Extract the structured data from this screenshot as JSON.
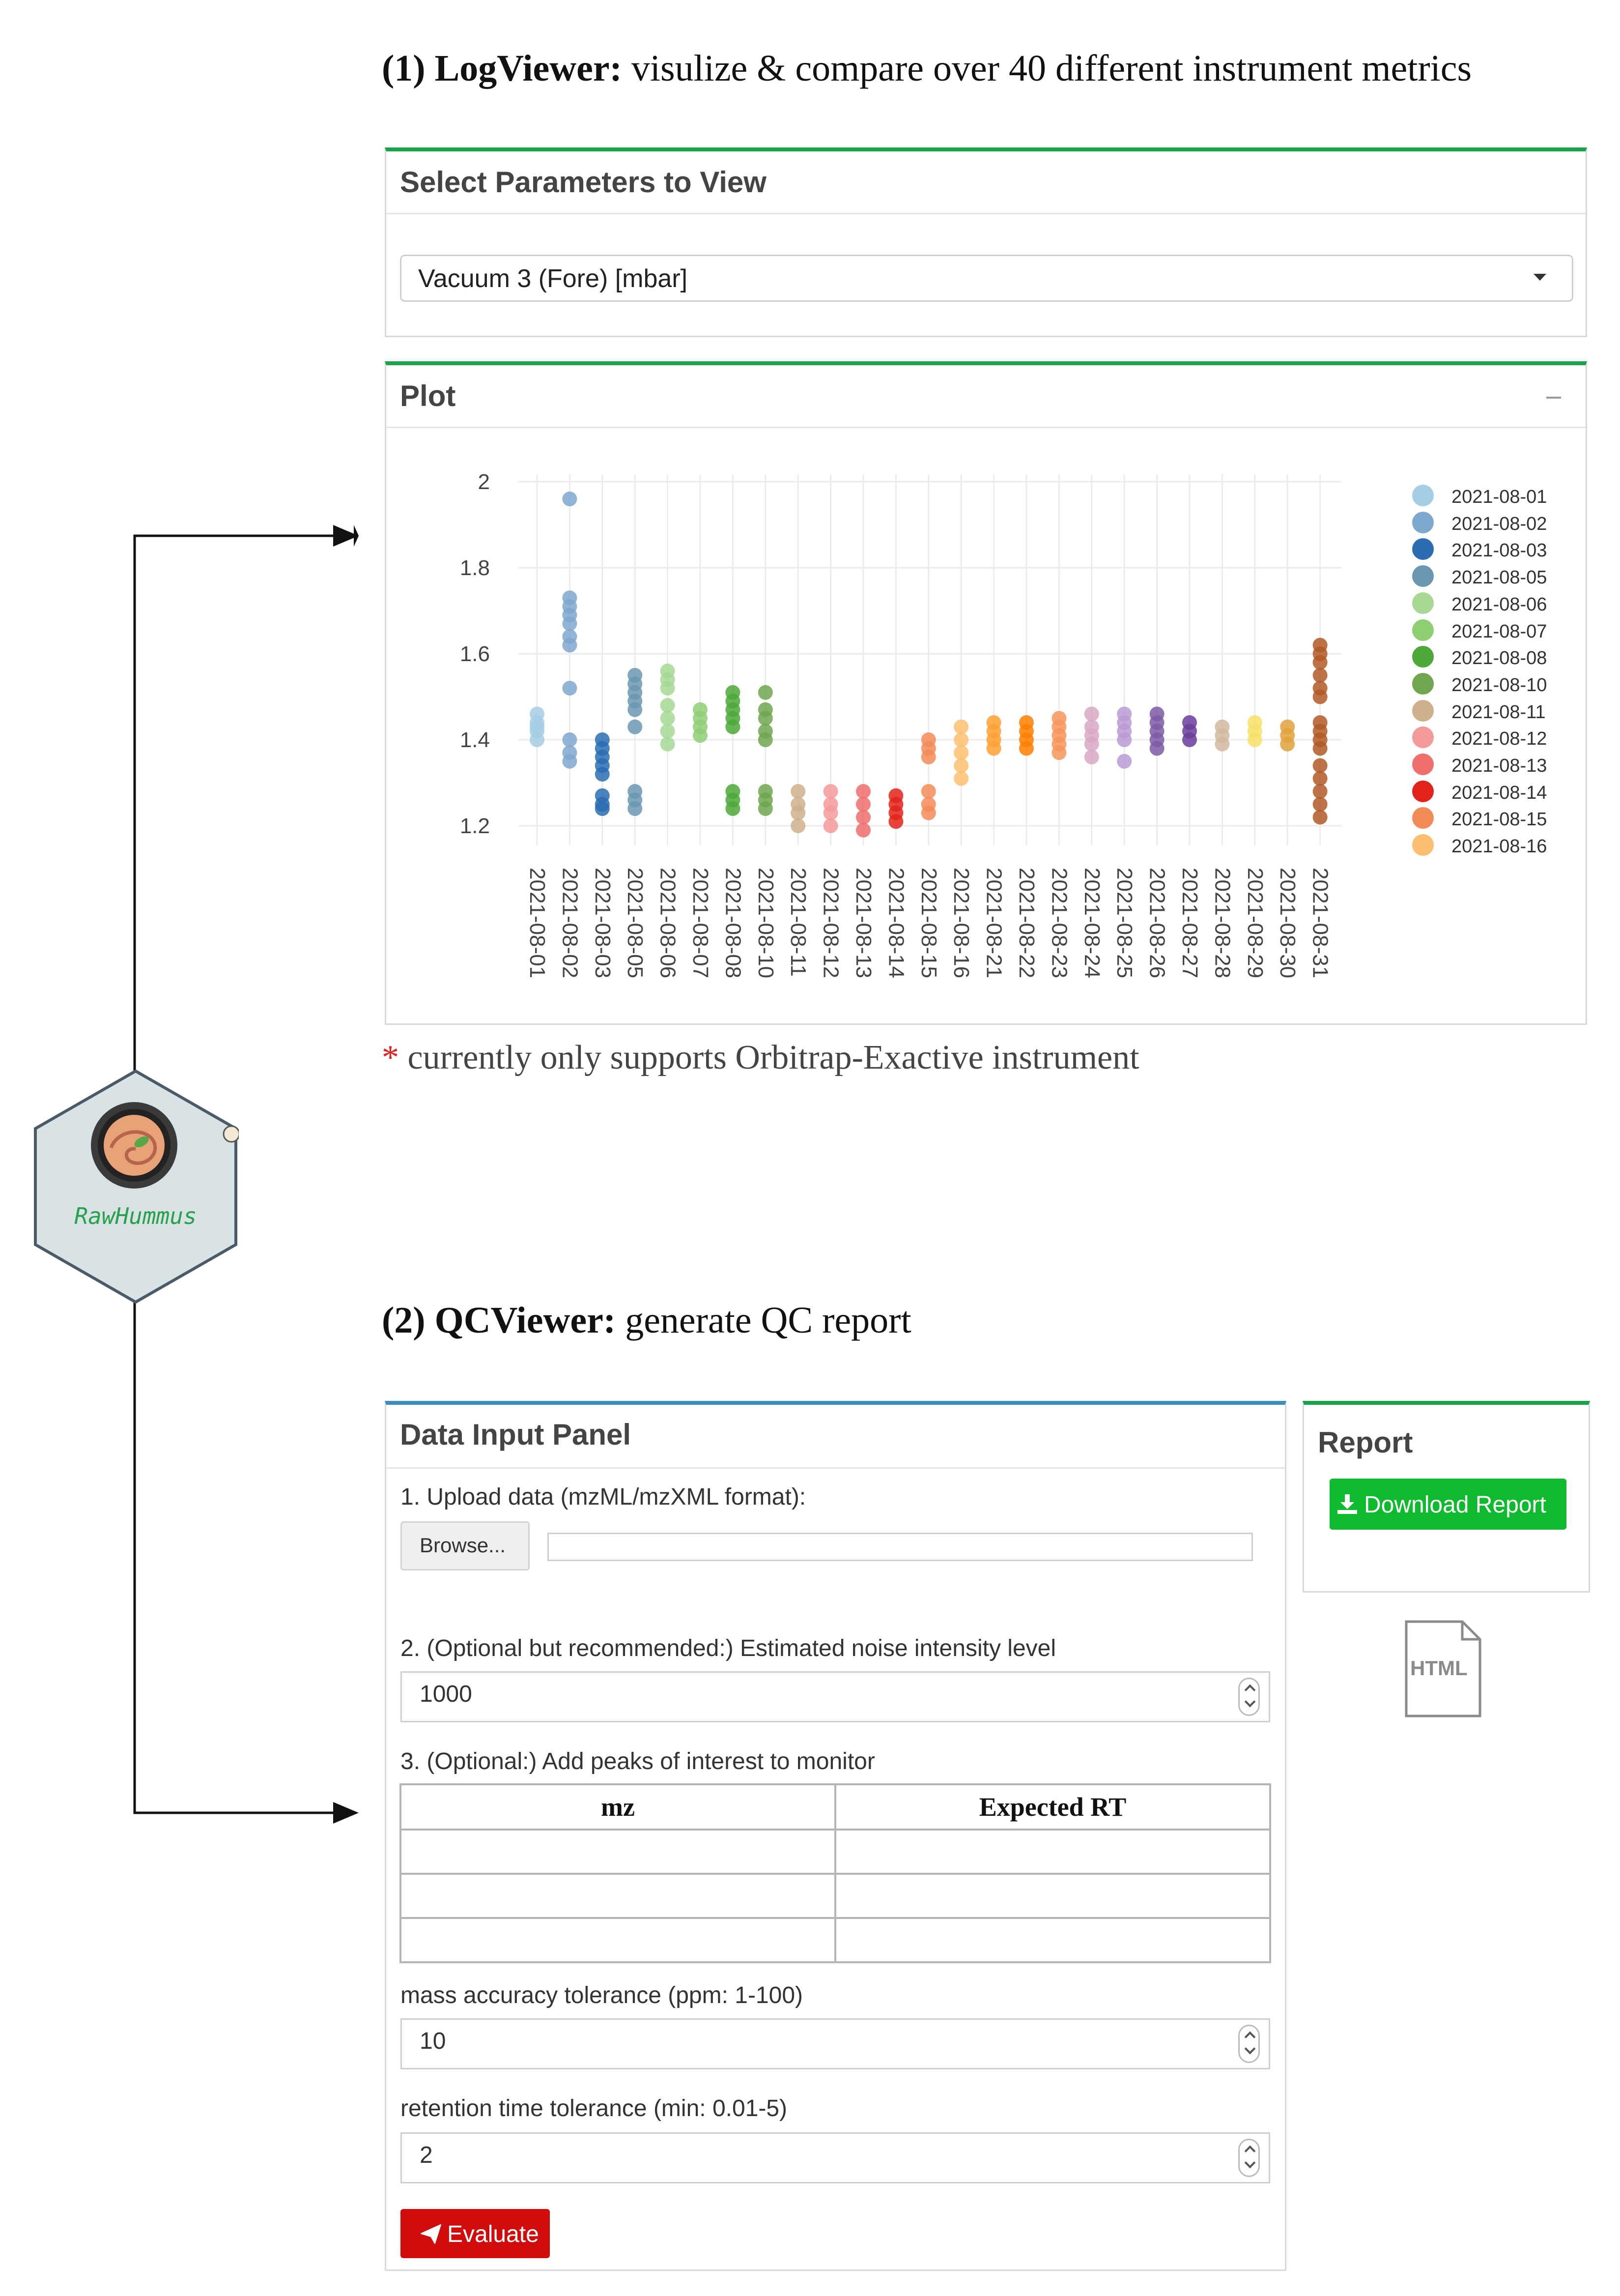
{
  "logviewer": {
    "heading_bold": "(1) LogViewer:",
    "heading_rest": " visulize & compare over 40 different instrument metrics",
    "params_box_title": "Select Parameters to View",
    "selected_parameter": "Vacuum 3 (Fore) [mbar]",
    "plot_box_title": "Plot",
    "footnote_mark": "*",
    "footnote_text": "currently only supports Orbitrap-Exactive instrument"
  },
  "logo": {
    "name": "RawHummus"
  },
  "qcviewer": {
    "heading_bold": "(2) QCViewer:",
    "heading_rest": " generate QC report",
    "panel_title": "Data Input Panel",
    "upload_label": "1. Upload data (mzML/mzXML format):",
    "browse_label": "Browse...",
    "noise_label": "2. (Optional but recommended:) Estimated noise intensity level",
    "noise_value": "1000",
    "peaks_label": "3. (Optional:) Add peaks of interest to monitor",
    "peaks_table": {
      "columns": [
        "mz",
        "Expected RT"
      ],
      "rows": [
        [
          "",
          ""
        ],
        [
          "",
          ""
        ],
        [
          "",
          ""
        ]
      ]
    },
    "mass_tol_label": "mass accuracy tolerance (ppm: 1-100)",
    "mass_tol_value": "10",
    "rt_tol_label": "retention time tolerance (min: 0.01-5)",
    "rt_tol_value": "2",
    "evaluate_label": "Evaluate",
    "report_title": "Report",
    "download_label": "Download Report",
    "html_file_label": "HTML"
  },
  "chart_data": {
    "type": "scatter",
    "title": "",
    "xlabel": "",
    "ylabel": "",
    "ylim": [
      1.15,
      2.02
    ],
    "yticks": [
      1.2,
      1.4,
      1.6,
      1.8,
      2
    ],
    "grid": true,
    "legend_position": "right",
    "categories": [
      "2021-08-01",
      "2021-08-02",
      "2021-08-03",
      "2021-08-05",
      "2021-08-06",
      "2021-08-07",
      "2021-08-08",
      "2021-08-10",
      "2021-08-11",
      "2021-08-12",
      "2021-08-13",
      "2021-08-14",
      "2021-08-15",
      "2021-08-16",
      "2021-08-21",
      "2021-08-22",
      "2021-08-23",
      "2021-08-24",
      "2021-08-25",
      "2021-08-26",
      "2021-08-27",
      "2021-08-28",
      "2021-08-29",
      "2021-08-30",
      "2021-08-31"
    ],
    "legend": [
      "2021-08-01",
      "2021-08-02",
      "2021-08-03",
      "2021-08-05",
      "2021-08-06",
      "2021-08-07",
      "2021-08-08",
      "2021-08-10",
      "2021-08-11",
      "2021-08-12",
      "2021-08-13",
      "2021-08-14",
      "2021-08-15",
      "2021-08-16"
    ],
    "series": [
      {
        "name": "2021-08-01",
        "color": "#a6cee3",
        "values": [
          1.4,
          1.42,
          1.43,
          1.44,
          1.46
        ]
      },
      {
        "name": "2021-08-02",
        "color": "#7fa8cf",
        "values": [
          1.35,
          1.37,
          1.4,
          1.52,
          1.62,
          1.64,
          1.67,
          1.69,
          1.71,
          1.73,
          1.96
        ]
      },
      {
        "name": "2021-08-03",
        "color": "#2a6db3",
        "values": [
          1.24,
          1.25,
          1.27,
          1.32,
          1.34,
          1.36,
          1.38,
          1.4
        ]
      },
      {
        "name": "2021-08-05",
        "color": "#6a98b2",
        "values": [
          1.24,
          1.26,
          1.28,
          1.43,
          1.47,
          1.49,
          1.51,
          1.53,
          1.55
        ]
      },
      {
        "name": "2021-08-06",
        "color": "#a6d894",
        "values": [
          1.39,
          1.42,
          1.45,
          1.48,
          1.52,
          1.54,
          1.56
        ]
      },
      {
        "name": "2021-08-07",
        "color": "#8fcf74",
        "values": [
          1.41,
          1.43,
          1.45,
          1.47
        ]
      },
      {
        "name": "2021-08-08",
        "color": "#4ea83a",
        "values": [
          1.24,
          1.26,
          1.28,
          1.43,
          1.45,
          1.47,
          1.49,
          1.51
        ]
      },
      {
        "name": "2021-08-10",
        "color": "#70a64f",
        "values": [
          1.24,
          1.26,
          1.28,
          1.4,
          1.42,
          1.45,
          1.47,
          1.51
        ]
      },
      {
        "name": "2021-08-11",
        "color": "#cdb08c",
        "values": [
          1.2,
          1.23,
          1.25,
          1.28
        ]
      },
      {
        "name": "2021-08-12",
        "color": "#f49a9a",
        "values": [
          1.2,
          1.23,
          1.25,
          1.28
        ]
      },
      {
        "name": "2021-08-13",
        "color": "#ef6f6c",
        "values": [
          1.19,
          1.22,
          1.25,
          1.28
        ]
      },
      {
        "name": "2021-08-14",
        "color": "#e2231a",
        "values": [
          1.21,
          1.23,
          1.25,
          1.27
        ]
      },
      {
        "name": "2021-08-15",
        "color": "#f38b58",
        "values": [
          1.23,
          1.25,
          1.28,
          1.36,
          1.38,
          1.4
        ]
      },
      {
        "name": "2021-08-16",
        "color": "#fdbf6f",
        "values": [
          1.31,
          1.34,
          1.37,
          1.4,
          1.43
        ]
      },
      {
        "name": "2021-08-21",
        "color": "#ffa033",
        "values": [
          1.38,
          1.4,
          1.42,
          1.44
        ]
      },
      {
        "name": "2021-08-22",
        "color": "#ff7f00",
        "values": [
          1.38,
          1.4,
          1.42,
          1.44
        ]
      },
      {
        "name": "2021-08-23",
        "color": "#f7955c",
        "values": [
          1.37,
          1.39,
          1.41,
          1.43,
          1.45
        ]
      },
      {
        "name": "2021-08-24",
        "color": "#d9a8c4",
        "values": [
          1.36,
          1.39,
          1.41,
          1.43,
          1.46
        ]
      },
      {
        "name": "2021-08-25",
        "color": "#b99bd3",
        "values": [
          1.35,
          1.4,
          1.42,
          1.44,
          1.46
        ]
      },
      {
        "name": "2021-08-26",
        "color": "#7e5aa6",
        "values": [
          1.38,
          1.4,
          1.42,
          1.44,
          1.46
        ]
      },
      {
        "name": "2021-08-27",
        "color": "#6a3d9a",
        "values": [
          1.4,
          1.42,
          1.44
        ]
      },
      {
        "name": "2021-08-28",
        "color": "#d3b9a0",
        "values": [
          1.39,
          1.41,
          1.43
        ]
      },
      {
        "name": "2021-08-29",
        "color": "#f7e066",
        "values": [
          1.4,
          1.42,
          1.44
        ]
      },
      {
        "name": "2021-08-30",
        "color": "#e1a23c",
        "values": [
          1.39,
          1.41,
          1.43
        ]
      },
      {
        "name": "2021-08-31",
        "color": "#b15928",
        "values": [
          1.22,
          1.25,
          1.28,
          1.31,
          1.34,
          1.38,
          1.4,
          1.42,
          1.44,
          1.5,
          1.52,
          1.55,
          1.58,
          1.6,
          1.62
        ]
      }
    ]
  },
  "colors": {
    "box_accent": "#1aa34a",
    "panel_accent": "#3c8dbc",
    "download_button": "#0fba2e",
    "evaluate_button": "#d00c0c",
    "logo_fill": "#d9e2e4",
    "logo_text": "#27a14b"
  },
  "icons": {
    "download": "download-icon",
    "evaluate": "paper-plane-icon",
    "html_file": "html-file-icon",
    "dropdown": "caret-down-icon",
    "collapse": "minus-icon"
  }
}
